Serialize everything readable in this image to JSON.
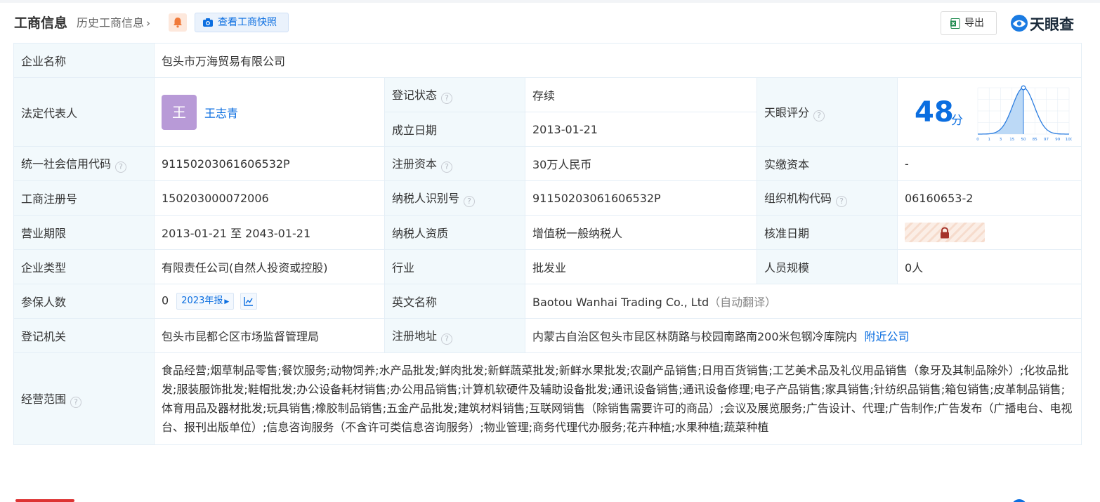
{
  "header": {
    "title": "工商信息",
    "history_link": "历史工商信息",
    "history_chevron": "chevron-right-icon",
    "bell_icon": "bell-icon",
    "snapshot_button": "查看工商快照",
    "snapshot_icon": "camera-icon",
    "export_button": "导出",
    "export_icon": "excel-icon",
    "logo_text": "天眼查"
  },
  "company": {
    "name_label": "企业名称",
    "name": "包头市万海贸易有限公司",
    "legal_rep_label": "法定代表人",
    "legal_rep_avatar": "王",
    "legal_rep": "王志青",
    "reg_status_label": "登记状态",
    "reg_status": "存续",
    "founded_label": "成立日期",
    "founded": "2013-01-21",
    "tianyan_score_label": "天眼评分",
    "score": "48",
    "score_unit": "分",
    "credit_code_label": "统一社会信用代码",
    "credit_code": "91150203061606532P",
    "reg_capital_label": "注册资本",
    "reg_capital": "30万人民币",
    "paid_capital_label": "实缴资本",
    "paid_capital": "-",
    "biz_reg_no_label": "工商注册号",
    "biz_reg_no": "150203000072006",
    "taxpayer_id_label": "纳税人识别号",
    "taxpayer_id": "91150203061606532P",
    "org_code_label": "组织机构代码",
    "org_code": "06160653-2",
    "term_label": "营业期限",
    "term": "2013-01-21 至 2043-01-21",
    "taxpayer_qual_label": "纳税人资质",
    "taxpayer_qual": "增值税一般纳税人",
    "approval_date_label": "核准日期",
    "approval_date_icon": "lock-icon",
    "company_type_label": "企业类型",
    "company_type": "有限责任公司(自然人投资或控股)",
    "industry_label": "行业",
    "industry": "批发业",
    "staff_size_label": "人员规模",
    "staff_size": "0人",
    "insured_label": "参保人数",
    "insured": "0",
    "insured_report": "2023年报",
    "insured_trend_icon": "trend-chart-icon",
    "english_name_label": "英文名称",
    "english_name": "Baotou Wanhai Trading Co., Ltd",
    "english_name_note": "（自动翻译）",
    "reg_authority_label": "登记机关",
    "reg_authority": "包头市昆都仑区市场监督管理局",
    "reg_address_label": "注册地址",
    "reg_address": "内蒙古自治区包头市昆区林荫路与校园南路南200米包钢冷库院内",
    "nearby_link": "附近公司",
    "scope_label": "经营范围",
    "scope": "食品经营;烟草制品零售;餐饮服务;动物饲养;水产品批发;鲜肉批发;新鲜蔬菜批发;新鲜水果批发;农副产品销售;日用百货销售;工艺美术品及礼仪用品销售（象牙及其制品除外）;化妆品批发;服装服饰批发;鞋帽批发;办公设备耗材销售;办公用品销售;计算机软硬件及辅助设备批发;通讯设备销售;通讯设备修理;电子产品销售;家具销售;针纺织品销售;箱包销售;皮革制品销售;体育用品及器材批发;玩具销售;橡胶制品销售;五金产品批发;建筑材料销售;互联网销售（除销售需要许可的商品）;会议及展览服务;广告设计、代理;广告制作;广告发布（广播电台、电视台、报刊出版单位）;信息咨询服务（不含许可类信息咨询服务）;物业管理;商务代理代办服务;花卉种植;水果种植;蔬菜种植",
    "help_icon": "question-circle-icon",
    "help_glyph": "?"
  },
  "score_chart": {
    "type": "area",
    "x_ticks": [
      "0",
      "1",
      "3",
      "15",
      "50",
      "85",
      "97",
      "99",
      "100"
    ],
    "marker_tick": "50",
    "colors": {
      "curve": "#2b7de0",
      "fill": "#bcd9f6",
      "grid": "#e6edf5"
    }
  },
  "colors": {
    "accent": "#0b6ee0",
    "status_green": "#15a26b",
    "label_bg": "#f2f9fc",
    "border": "#e4eef6",
    "avatar": "#b89ad7"
  }
}
